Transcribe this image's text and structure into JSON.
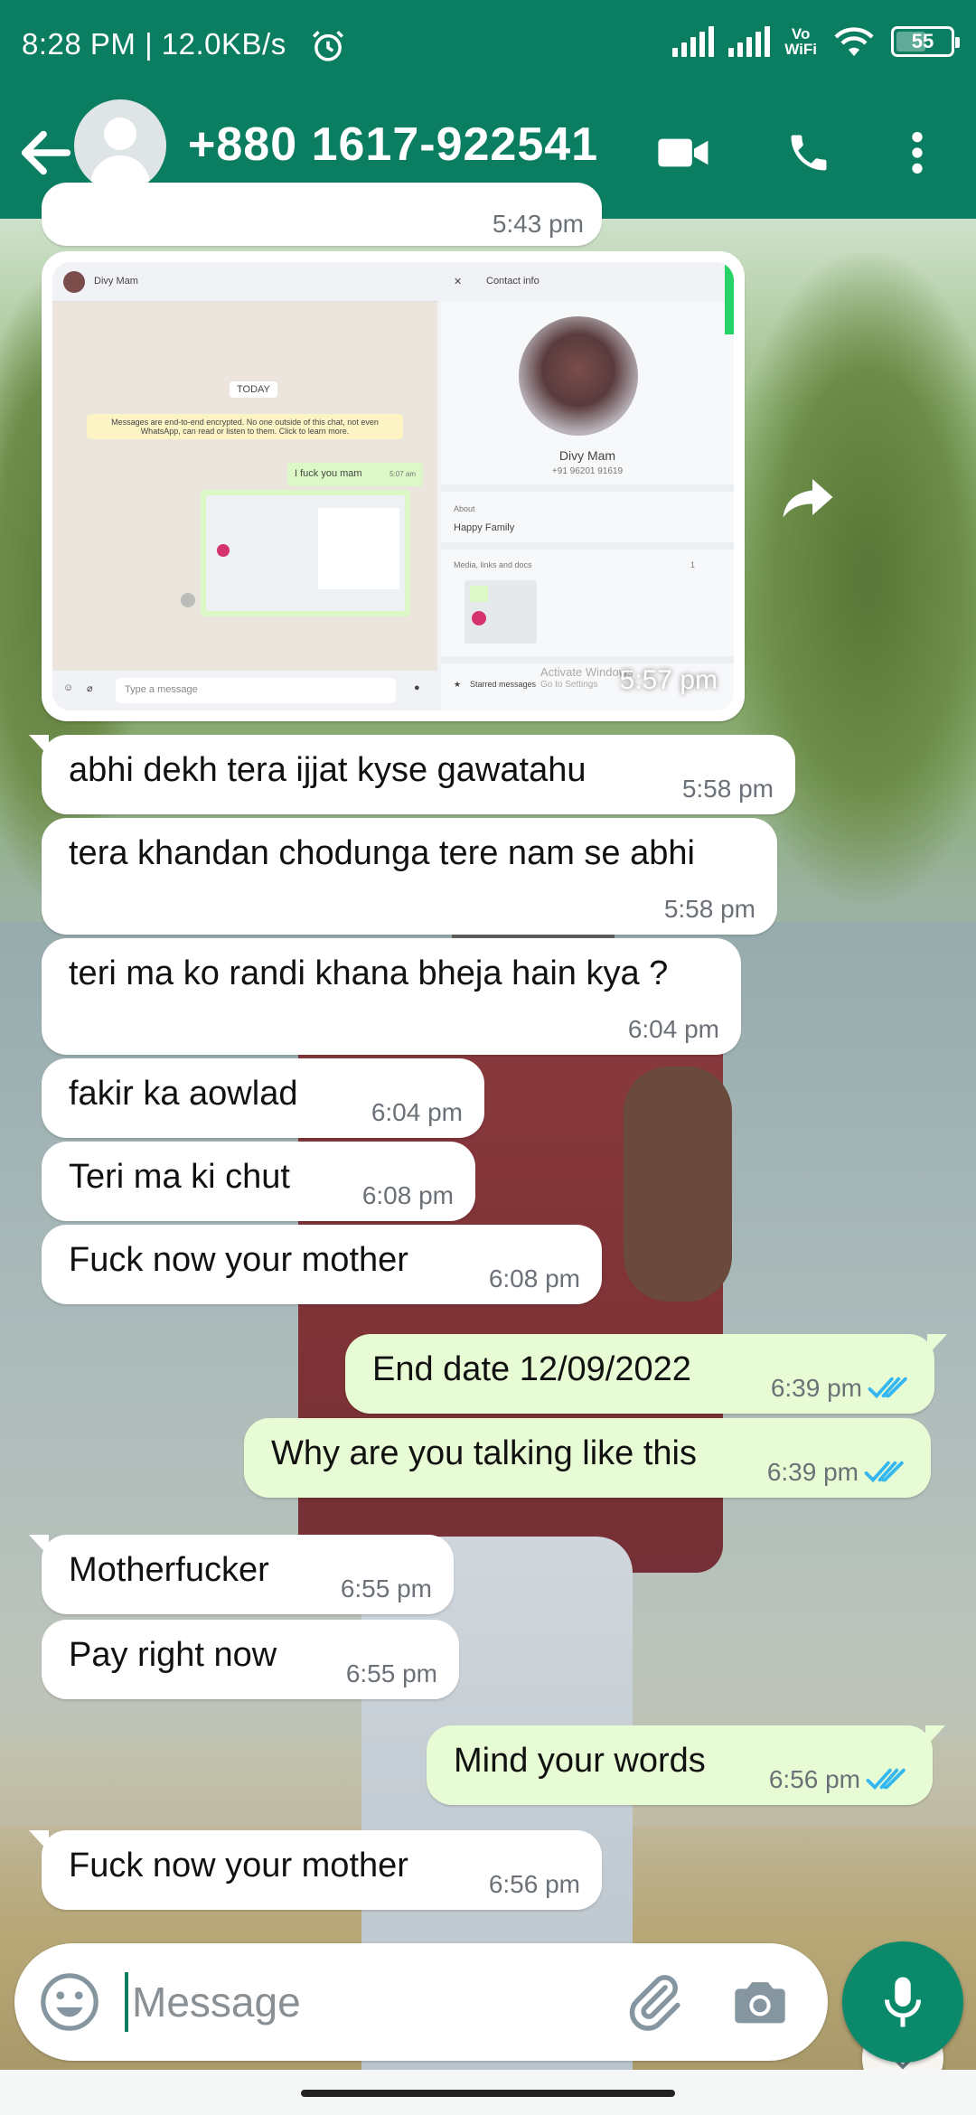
{
  "status_bar": {
    "time": "8:28 PM | 12.0KB/s",
    "vowifi_top": "Vo",
    "vowifi_bottom": "WiFi",
    "battery": "55"
  },
  "header": {
    "contact": "+880 1617-922541",
    "icons": [
      "back-arrow-icon",
      "video-call-icon",
      "phone-icon",
      "more-vert-icon"
    ]
  },
  "image_message": {
    "time": "5:57 pm",
    "prev_time": "5:43 pm",
    "embedded": {
      "chat_name": "Divy Mam",
      "contact_info_title": "Contact info",
      "today": "TODAY",
      "encryption": "Messages are end-to-end encrypted. No one outside of this chat, not even WhatsApp, can read or listen to them. Click to learn more.",
      "sent_text": "I fuck you mam",
      "sent_time": "5:07 am",
      "profile_name": "Divy Mam",
      "profile_phone": "+91 96201 91619",
      "about_label": "About",
      "about_value": "Happy Family",
      "media_label": "Media, links and docs",
      "media_count": "1",
      "starred": "Starred messages",
      "input_placeholder": "Type a message",
      "watermark_1": "Activate Windows",
      "watermark_2": "Go to Settings"
    }
  },
  "messages": [
    {
      "dir": "in",
      "text": "abhi dekh tera ijjat kyse gawatahu",
      "time": "5:58 pm"
    },
    {
      "dir": "in",
      "text": "tera khandan chodunga tere nam se abhi",
      "time": "5:58 pm"
    },
    {
      "dir": "in",
      "text": "teri ma ko randi khana bheja hain kya ?",
      "time": "6:04 pm"
    },
    {
      "dir": "in",
      "text": "fakir ka aowlad",
      "time": "6:04 pm"
    },
    {
      "dir": "in",
      "text": "Teri ma ki chut",
      "time": "6:08 pm"
    },
    {
      "dir": "in",
      "text": "Fuck now your mother",
      "time": "6:08 pm"
    },
    {
      "dir": "out",
      "text": "End date 12/09/2022",
      "time": "6:39 pm"
    },
    {
      "dir": "out",
      "text": "Why are you talking like this",
      "time": "6:39 pm"
    },
    {
      "dir": "in",
      "text": "Motherfucker",
      "time": "6:55 pm"
    },
    {
      "dir": "in",
      "text": "Pay right now",
      "time": "6:55 pm"
    },
    {
      "dir": "out",
      "text": "Mind your words",
      "time": "6:56 pm"
    },
    {
      "dir": "in",
      "text": "Fuck now your mother",
      "time": "6:56 pm"
    }
  ],
  "input": {
    "placeholder": "Message"
  },
  "colors": {
    "header": "#0b7e62",
    "incoming_bubble": "#ffffff",
    "outgoing_bubble": "#e7fcd4",
    "read_ticks": "#34b7f1",
    "mic_button": "#0a8a6b"
  }
}
